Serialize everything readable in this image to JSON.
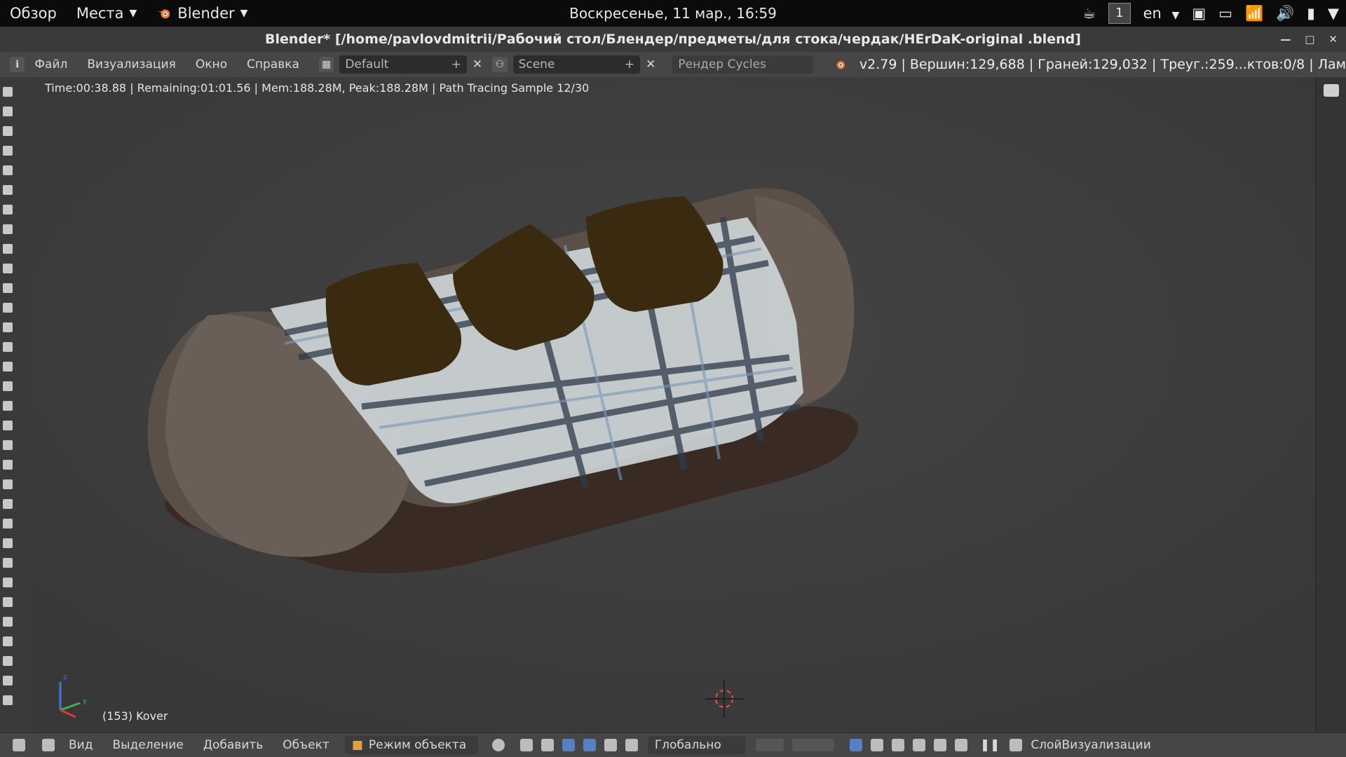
{
  "topbar": {
    "overview": "Обзор",
    "places": "Места",
    "app": "Blender",
    "clock": "Воскресенье, 11 мар., 16:59",
    "workspace": "1",
    "lang": "en"
  },
  "window": {
    "title": "Blender* [/home/pavlovdmitrii/Рабочий стол/Блендер/предметы/для стока/чердак/HErDaK-original .blend]"
  },
  "info_header": {
    "menus": [
      "Файл",
      "Визуализация",
      "Окно",
      "Справка"
    ],
    "layout": "Default",
    "scene": "Scene",
    "engine": "Рендер Cycles",
    "stats": "v2.79 | Вершин:129,688 | Граней:129,032 | Треуг.:259...ктов:0/8 | Лам"
  },
  "viewport": {
    "render_info": "Time:00:38.88 | Remaining:01:01.56 | Mem:188.28M, Peak:188.28M | Path Tracing Sample 12/30",
    "object_label": "(153) Kover"
  },
  "bottom_header": {
    "menus": [
      "Вид",
      "Выделение",
      "Добавить",
      "Объект"
    ],
    "mode": "Режим объекта",
    "orientation": "Глобально",
    "layer": "СлойВизуализации"
  },
  "colors": {
    "sofa_frame": "#5b5048",
    "sofa_base": "#3a2a24",
    "blanket": "#cfd6da",
    "blanket_stripe": "#2f3a4a",
    "pillow": "#3a2a10",
    "accent_blue": "#5680c2"
  },
  "icons": {
    "blender": "blender-logo-icon",
    "wifi": "wifi-icon",
    "volume": "volume-icon",
    "battery": "battery-icon",
    "power": "power-menu-icon"
  }
}
